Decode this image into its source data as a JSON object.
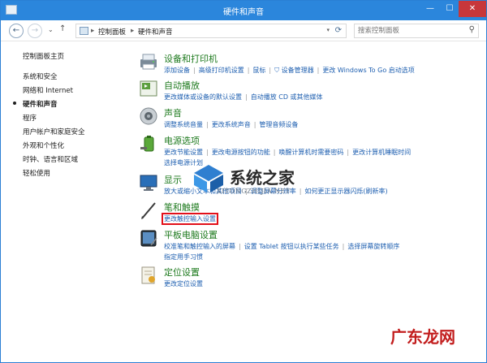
{
  "window": {
    "title": "硬件和声音",
    "controls": {
      "min": "—",
      "max": "☐",
      "close": "✕"
    }
  },
  "nav": {
    "back": "←",
    "forward": "→",
    "recent": "⌄",
    "up": "↑",
    "breadcrumb_sep1": "▸",
    "crumb1": "控制面板",
    "breadcrumb_sep2": "▸",
    "crumb2": "硬件和声音",
    "dropdown": "▾",
    "refresh": "⟳"
  },
  "search": {
    "placeholder": "搜索控制面板",
    "icon": "⚲"
  },
  "sidebar": {
    "home": "控制面板主页",
    "items": [
      {
        "label": "系统和安全",
        "active": false
      },
      {
        "label": "网络和 Internet",
        "active": false
      },
      {
        "label": "硬件和声音",
        "active": true
      },
      {
        "label": "程序",
        "active": false
      },
      {
        "label": "用户帐户和家庭安全",
        "active": false
      },
      {
        "label": "外观和个性化",
        "active": false
      },
      {
        "label": "时钟、语言和区域",
        "active": false
      },
      {
        "label": "轻松使用",
        "active": false
      }
    ]
  },
  "sections": [
    {
      "title": "设备和打印机",
      "icon": "printer-icon",
      "links": [
        "添加设备",
        "高级打印机设置",
        "鼠标",
        "设备管理器",
        "更改 Windows To Go 启动选项"
      ]
    },
    {
      "title": "自动播放",
      "icon": "autoplay-icon",
      "links": [
        "更改媒体或设备的默认设置",
        "自动播放 CD 或其他媒体"
      ]
    },
    {
      "title": "声音",
      "icon": "speaker-icon",
      "links": [
        "调整系统音量",
        "更改系统声音",
        "管理音频设备"
      ]
    },
    {
      "title": "电源选项",
      "icon": "battery-icon",
      "links": [
        "更改节能设置",
        "更改电源按钮的功能",
        "唤醒计算机时需要密码",
        "更改计算机睡眠时间",
        "选择电源计划"
      ]
    },
    {
      "title": "显示",
      "icon": "display-icon",
      "links": [
        "放大或缩小文本和其他项目",
        "调整屏幕分辨率",
        "如何更正显示器闪烁(刷新率)"
      ]
    },
    {
      "title": "笔和触摸",
      "icon": "pen-icon",
      "links": [
        "更改触控输入设置"
      ]
    },
    {
      "title": "平板电脑设置",
      "icon": "tablet-icon",
      "links": [
        "校准笔和触控输入的屏幕",
        "设置 Tablet 按钮以执行某些任务",
        "选择屏幕旋转顺序",
        "指定用手习惯"
      ]
    },
    {
      "title": "定位设置",
      "icon": "location-icon",
      "links": [
        "更改定位设置"
      ]
    }
  ],
  "watermarks": {
    "site_name": "系统之家",
    "site_url": "XITONGZHIJIA.NET",
    "corner": "广东龙网"
  },
  "colors": {
    "titlebar": "#2b86dc",
    "heading": "#1e7a1e",
    "link": "#1e5fb0",
    "highlight": "#e2101a"
  }
}
